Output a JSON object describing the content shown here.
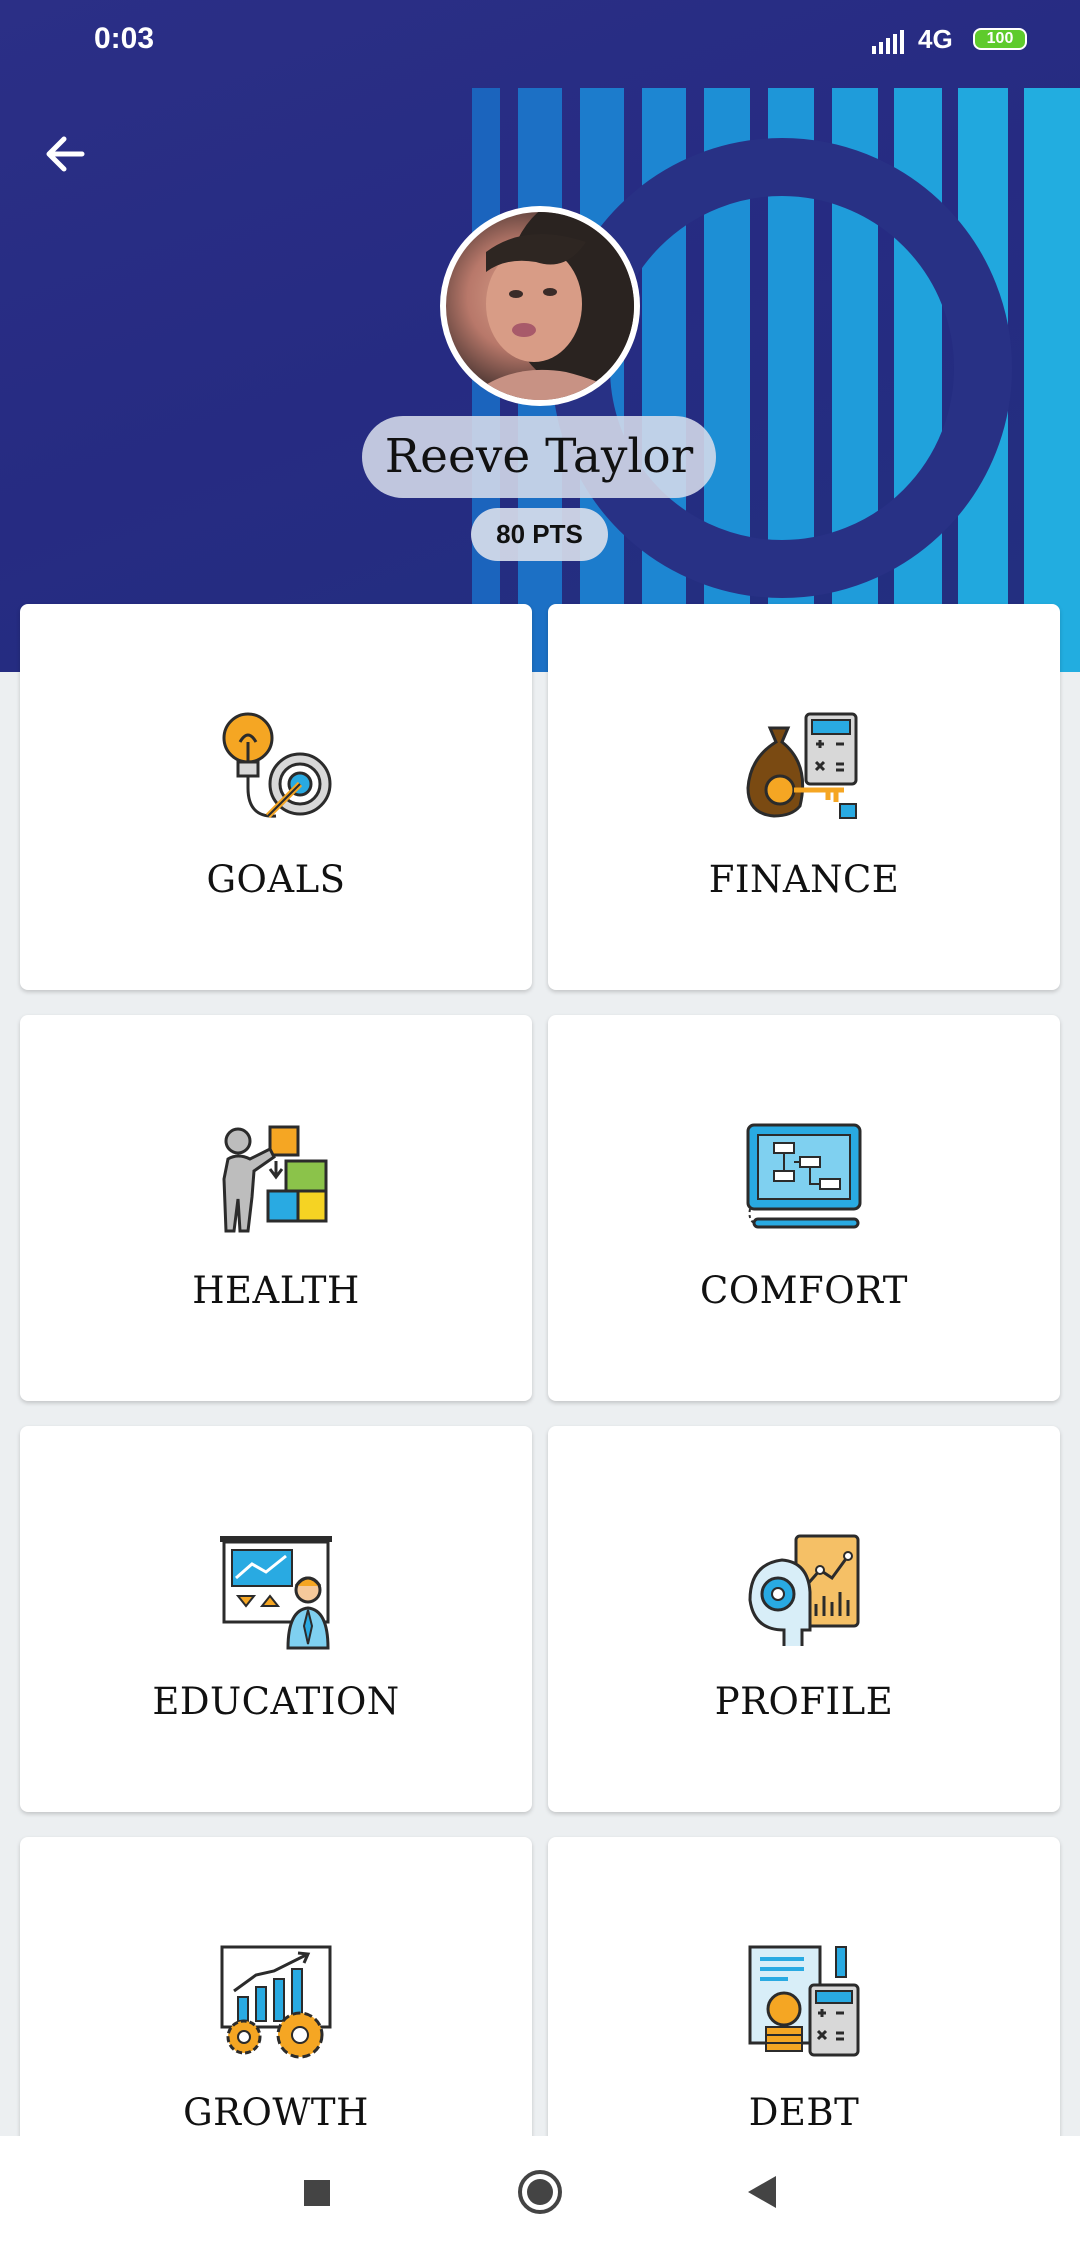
{
  "status_bar": {
    "time": "0:03",
    "network": "4G",
    "battery": "100"
  },
  "profile": {
    "name": "Reeve Taylor",
    "points": "80 PTS"
  },
  "menu": [
    {
      "label": "GOALS",
      "icon": "goal-target-icon"
    },
    {
      "label": "FINANCE",
      "icon": "money-bag-calculator-icon"
    },
    {
      "label": "HEALTH",
      "icon": "puzzle-person-icon"
    },
    {
      "label": "COMFORT",
      "icon": "tablet-flowchart-icon"
    },
    {
      "label": "EDUCATION",
      "icon": "presentation-board-icon"
    },
    {
      "label": "PROFILE",
      "icon": "head-gear-chart-icon"
    },
    {
      "label": "GROWTH",
      "icon": "growth-chart-gears-icon"
    },
    {
      "label": "DEBT",
      "icon": "invoice-coins-calculator-icon"
    }
  ],
  "colors": {
    "header": "#262b82",
    "stripe": "#1e9ad9",
    "background": "#eceff1",
    "icon_orange": "#f5a623",
    "icon_blue": "#29aae2",
    "icon_dark": "#2b2b2b"
  }
}
